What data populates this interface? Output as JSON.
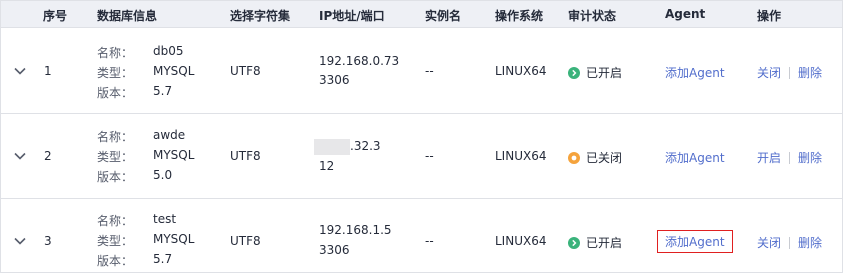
{
  "headers": {
    "index": "序号",
    "db_info": "数据库信息",
    "charset": "选择字符集",
    "ip_port": "IP地址/端口",
    "instance": "实例名",
    "os": "操作系统",
    "audit": "审计状态",
    "agent": "Agent",
    "ops": "操作"
  },
  "labels": {
    "name": "名称：",
    "type": "类型：",
    "version": "版本："
  },
  "rows": [
    {
      "index": "1",
      "name": "db05",
      "type": "MYSQL",
      "version": "5.7",
      "charset": "UTF8",
      "ip_line1": "192.168.0.73",
      "ip_line2": "3306",
      "instance": "--",
      "os": "LINUX64",
      "audit_status": "已开启",
      "audit_state": "on",
      "agent_action": "添加Agent",
      "op_toggle": "关闭",
      "op_delete": "删除"
    },
    {
      "index": "2",
      "name": "awde",
      "type": "MYSQL",
      "version": "5.0",
      "charset": "UTF8",
      "ip_line1": ".32.3",
      "ip_line2": "12",
      "instance": "--",
      "os": "LINUX64",
      "audit_status": "已关闭",
      "audit_state": "off",
      "agent_action": "添加Agent",
      "op_toggle": "开启",
      "op_delete": "删除"
    },
    {
      "index": "3",
      "name": "test",
      "type": "MYSQL",
      "version": "5.7",
      "charset": "UTF8",
      "ip_line1": "192.168.1.5",
      "ip_line2": "3306",
      "instance": "--",
      "os": "LINUX64",
      "audit_status": "已开启",
      "audit_state": "on",
      "agent_action": "添加Agent",
      "op_toggle": "关闭",
      "op_delete": "删除"
    }
  ],
  "colors": {
    "link": "#526ecc",
    "status_on": "#3ab37b",
    "status_off": "#f5a33c",
    "highlight_border": "#e02020",
    "header_bg": "#eef0f5"
  },
  "icons": {
    "expand": "chevron-down-icon",
    "status_on": "check-circle-icon",
    "status_off": "minus-circle-icon"
  }
}
